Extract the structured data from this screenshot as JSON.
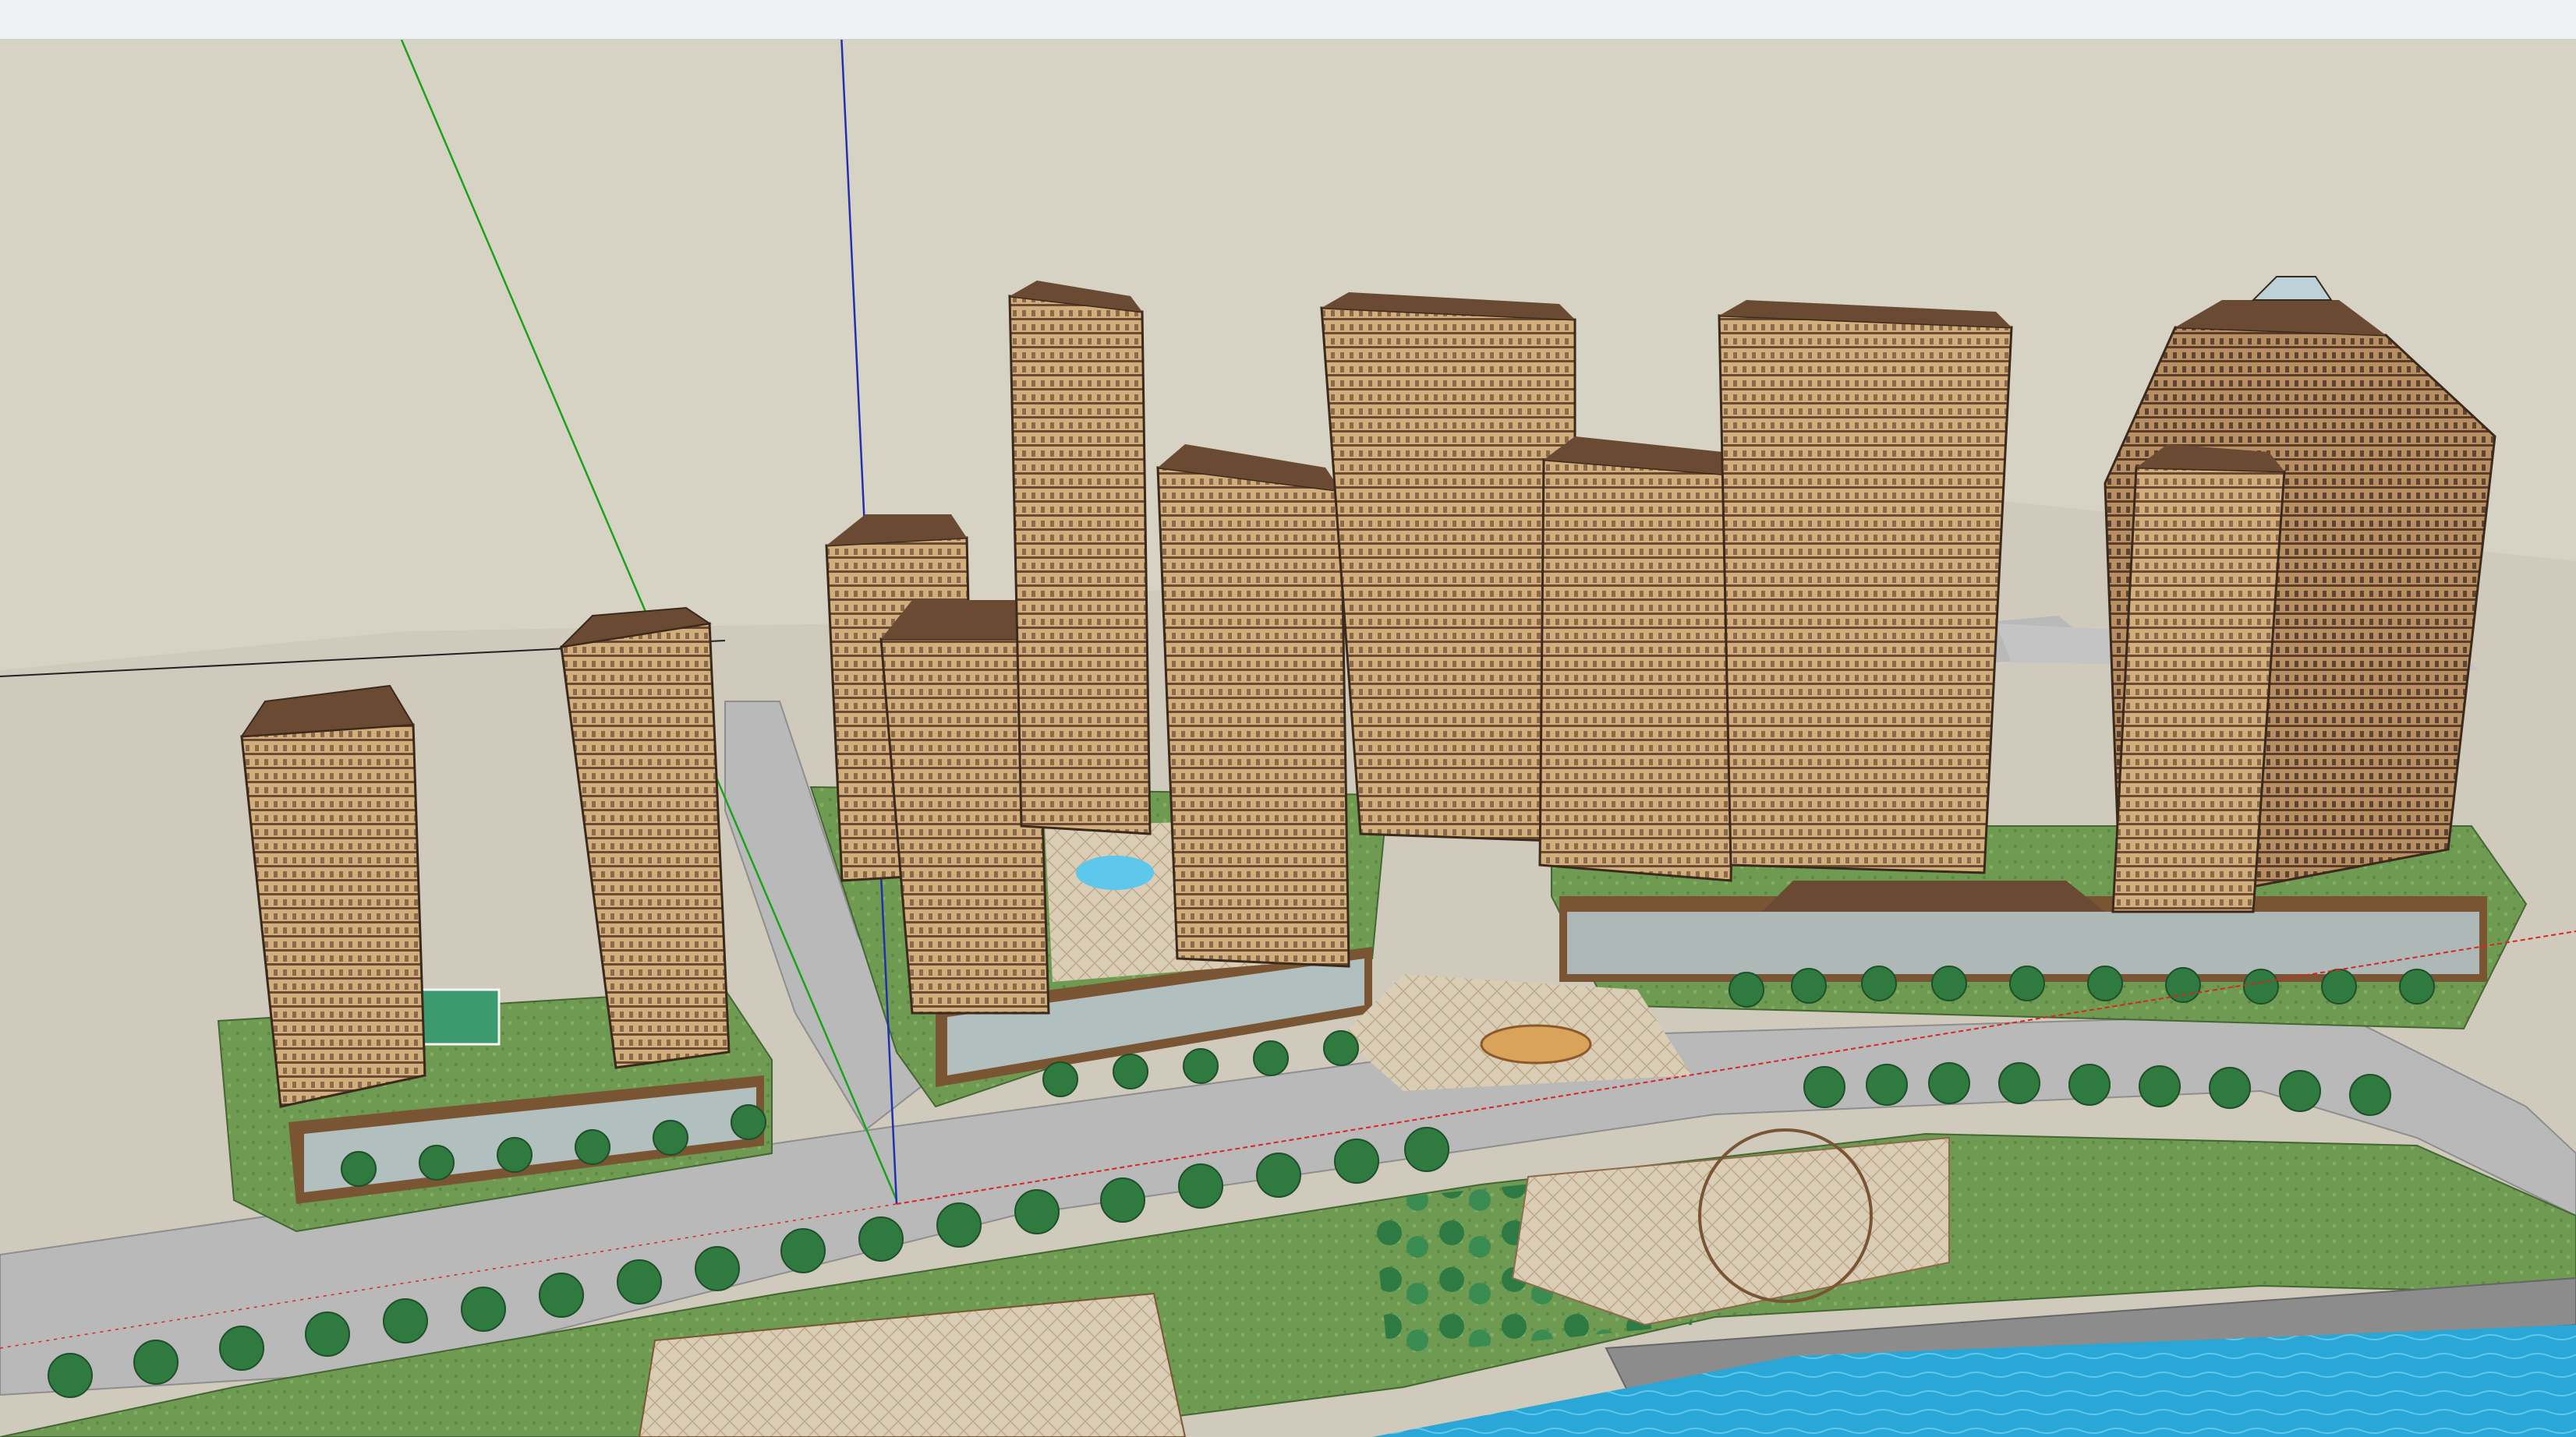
{
  "app": {
    "title": ""
  },
  "colors": {
    "toolbar": "#eef0f2",
    "sky": "#d6d2c4",
    "road": "#b9b9b9",
    "lawn": "#6f9a52",
    "water": "#2aa7d6",
    "building_light": "#d2ae7c",
    "building_dark": "#7a5534",
    "roof": "#6b4a33",
    "axis_red": "#d22",
    "axis_green": "#1aa31a",
    "axis_blue": "#1f2fb0"
  },
  "icons": {
    "axes": "axis-lines-icon"
  }
}
